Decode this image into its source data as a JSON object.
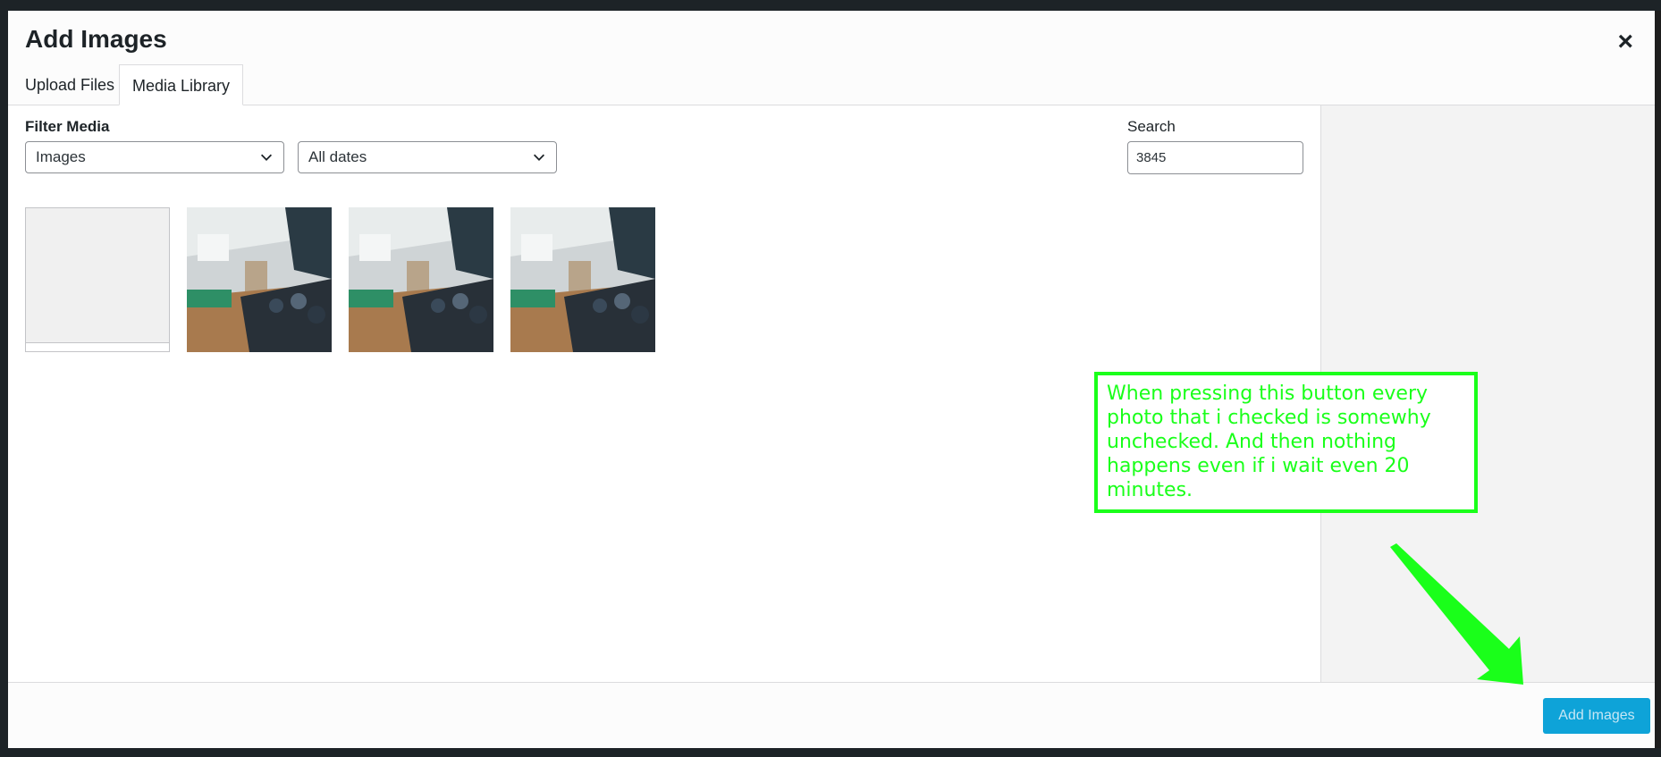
{
  "modal": {
    "title": "Add Images",
    "close_symbol": "×",
    "tabs": [
      {
        "label": "Upload Files",
        "active": false
      },
      {
        "label": "Media Library",
        "active": true
      }
    ]
  },
  "filters": {
    "label": "Filter Media",
    "type_select": {
      "value": "Images"
    },
    "date_select": {
      "value": "All dates"
    }
  },
  "search": {
    "label": "Search",
    "value": "3845"
  },
  "media_items": [
    {
      "kind": "placeholder"
    },
    {
      "kind": "photo"
    },
    {
      "kind": "photo"
    },
    {
      "kind": "photo"
    }
  ],
  "footer": {
    "primary_button": "Add Images"
  },
  "annotation": {
    "text": "When pressing this button every photo that i checked is somewhy unchecked. And then nothing happens even if i wait even 20 minutes.",
    "color": "#1aff1a"
  },
  "icons": {
    "close": "close-icon",
    "dropdown": "chevron-down-icon",
    "pointer": "arrow-annotation-icon"
  },
  "colors": {
    "primary_button": "#0ea3d8",
    "annotation": "#1aff1a"
  }
}
